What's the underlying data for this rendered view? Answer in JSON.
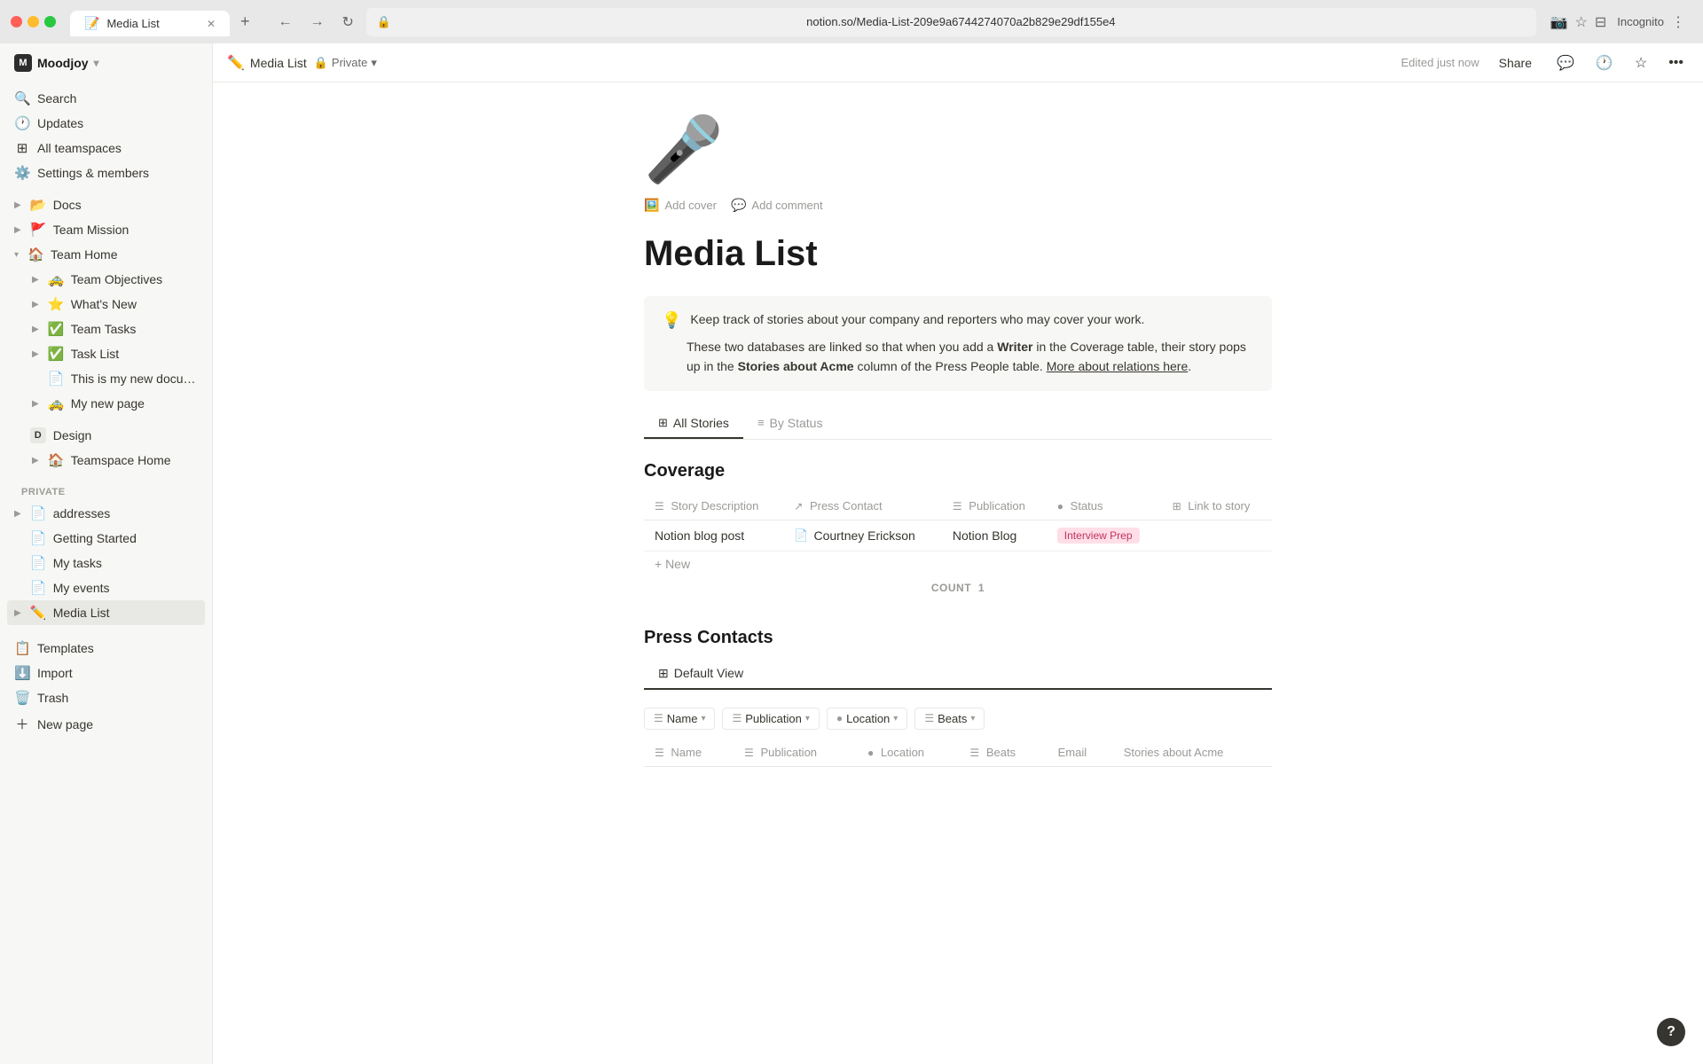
{
  "browser": {
    "tab_title": "Media List",
    "url": "notion.so/Media-List-209e9a6744274070a2b829e29df155e4",
    "tab_icon": "📝",
    "new_tab_btn": "+",
    "back_btn": "←",
    "forward_btn": "→",
    "refresh_btn": "↻",
    "lock_icon": "🔒",
    "incognito_label": "Incognito"
  },
  "sidebar": {
    "workspace_initial": "M",
    "workspace_name": "Moodjoy",
    "workspace_chevron": "▾",
    "search_label": "Search",
    "updates_label": "Updates",
    "all_teamspaces_label": "All teamspaces",
    "settings_label": "Settings & members",
    "docs_label": "Docs",
    "team_mission_label": "Team Mission",
    "team_home_label": "Team Home",
    "team_objectives_label": "Team Objectives",
    "whats_new_label": "What's New",
    "team_tasks_label": "Team Tasks",
    "task_list_label": "Task List",
    "this_is_my_new_document_label": "This is my new document",
    "my_new_page_label": "My new page",
    "design_label": "Design",
    "design_initial": "D",
    "teamspace_home_label": "Teamspace Home",
    "private_section_label": "Private",
    "addresses_label": "addresses",
    "getting_started_label": "Getting Started",
    "my_tasks_label": "My tasks",
    "my_events_label": "My events",
    "media_list_label": "Media List",
    "templates_label": "Templates",
    "import_label": "Import",
    "trash_label": "Trash",
    "new_page_label": "New page"
  },
  "topbar": {
    "edit_icon": "✏️",
    "page_title": "Media List",
    "privacy_icon": "🔒",
    "privacy_label": "Private",
    "privacy_chevron": "▾",
    "edited_label": "Edited just now",
    "share_label": "Share",
    "comment_icon": "💬",
    "history_icon": "🕐",
    "bookmark_icon": "☆",
    "more_icon": "•••"
  },
  "page": {
    "icon": "🎤",
    "add_cover_label": "Add cover",
    "add_comment_label": "Add comment",
    "title": "Media List",
    "callout_icon": "💡",
    "callout_text": "Keep track of stories about your company and reporters who may cover your work.",
    "callout_subtext_before": "These two databases are linked so that when you add a ",
    "callout_bold1": "Writer",
    "callout_subtext_mid": " in the Coverage table, their story pops up in the ",
    "callout_bold2": "Stories about Acme",
    "callout_subtext_end": " column of the Press People table. ",
    "callout_link_text": "More about relations here",
    "callout_period": "."
  },
  "tabs": {
    "all_stories_icon": "⊞",
    "all_stories_label": "All Stories",
    "by_status_icon": "≡",
    "by_status_label": "By Status"
  },
  "coverage": {
    "title": "Coverage",
    "col_story_description": "Story Description",
    "col_press_contact": "Press Contact",
    "col_publication": "Publication",
    "col_status": "Status",
    "col_link": "Link to story",
    "col_icon_story": "☰",
    "col_icon_relation": "↗",
    "col_icon_publication": "☰",
    "col_icon_status": "●",
    "col_icon_link": "⊞",
    "row1_story": "Notion blog post",
    "row1_contact": "Courtney Erickson",
    "row1_publication": "Notion Blog",
    "row1_status": "Interview Prep",
    "new_label": "+ New",
    "count_label": "COUNT",
    "count_value": "1"
  },
  "press_contacts": {
    "title": "Press Contacts",
    "default_view_icon": "⊞",
    "default_view_label": "Default View",
    "filter_name_label": "Name",
    "filter_publication_label": "Publication",
    "filter_location_label": "Location",
    "filter_beats_label": "Beats",
    "col_name": "Name",
    "col_publication": "Publication",
    "col_location": "Location",
    "col_beats": "Beats",
    "col_email": "Email",
    "col_stories": "Stories about Acme"
  },
  "help_btn": "?"
}
